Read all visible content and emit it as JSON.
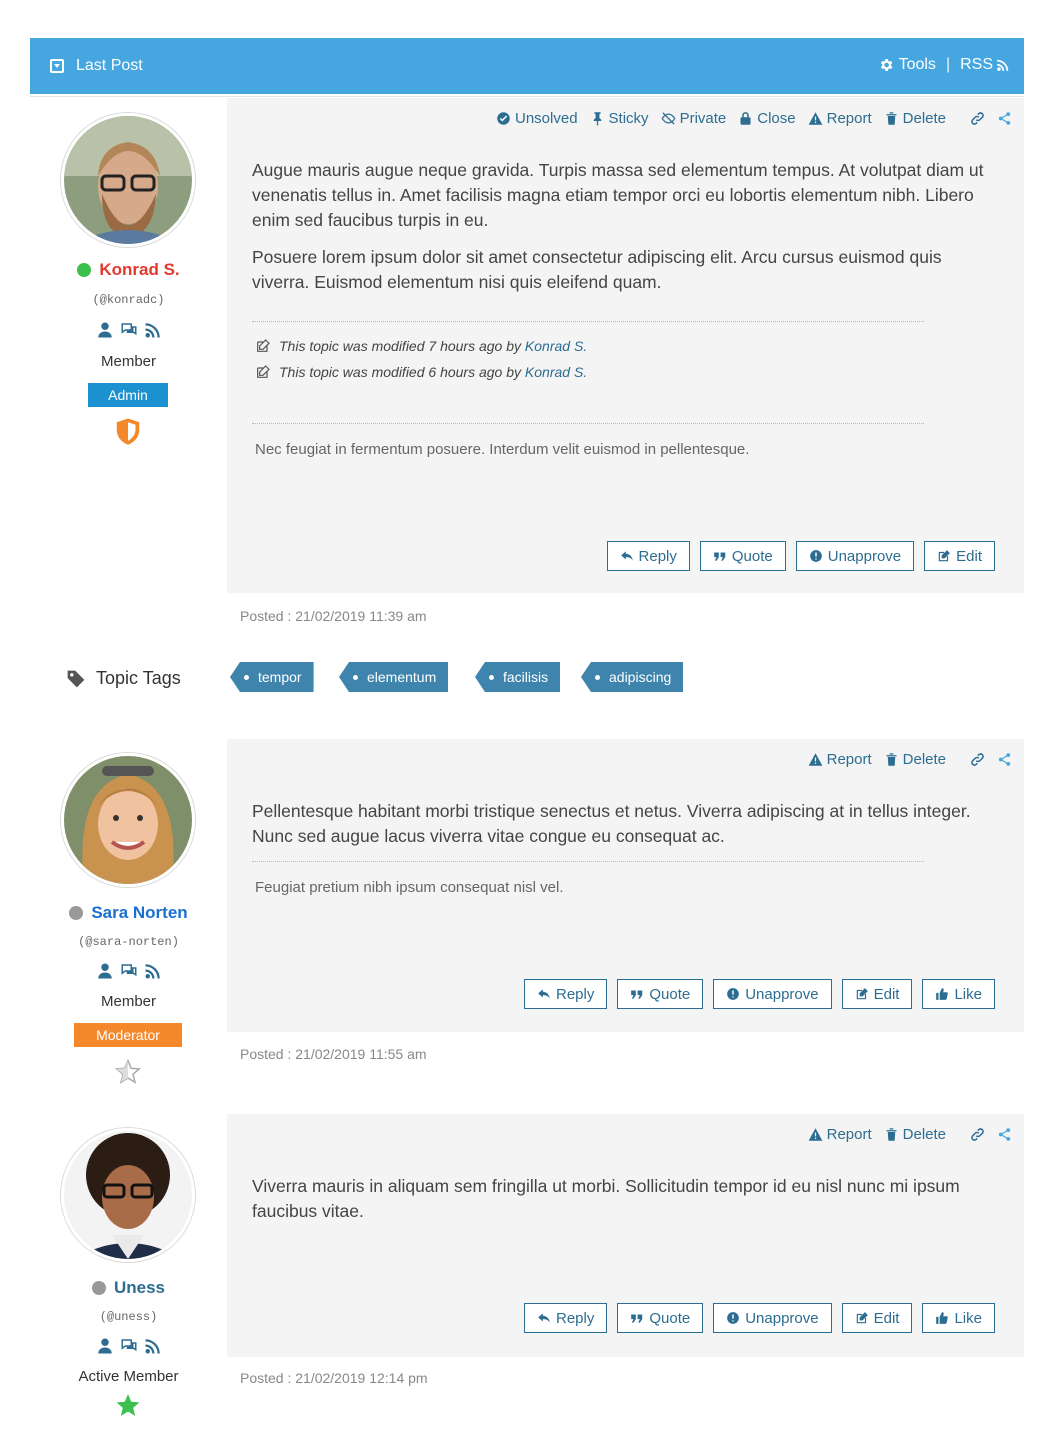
{
  "header": {
    "title": "Last Post",
    "tools": "Tools",
    "sep": "|",
    "rss": "RSS"
  },
  "posts": [
    {
      "author": {
        "name": "Konrad S.",
        "handle": "(@konradc)",
        "role": "Member",
        "badge": "Admin",
        "status_color": "#3cc04e",
        "name_color": "#e23a2b",
        "badge_color": "#1b91d0",
        "rank_icon": "shield-icon"
      },
      "actions": [
        "Unsolved",
        "Sticky",
        "Private",
        "Close",
        "Report",
        "Delete"
      ],
      "paragraphs": [
        "Augue mauris augue neque gravida. Turpis massa sed elementum tempus. At volutpat diam ut venenatis tellus in. Amet facilisis magna etiam tempor orci eu lobortis elementum nibh. Libero enim sed faucibus turpis in eu.",
        "Posuere lorem ipsum dolor sit amet consectetur adipiscing elit. Arcu cursus euismod quis viverra. Euismod elementum nisi quis eleifend quam."
      ],
      "modified": [
        {
          "text": "This topic was modified 7 hours ago by",
          "by": "Konrad S."
        },
        {
          "text": "This topic was modified 6 hours ago by",
          "by": "Konrad S."
        }
      ],
      "signature": "Nec feugiat in fermentum posuere. Interdum velit euismod in pellentesque.",
      "buttons": [
        "Reply",
        "Quote",
        "Unapprove",
        "Edit"
      ],
      "posted": "Posted : 21/02/2019 11:39 am"
    },
    {
      "author": {
        "name": "Sara Norten",
        "handle": "(@sara-norten)",
        "role": "Member",
        "badge": "Moderator",
        "status_color": "#999999",
        "name_color": "#1b6fd0",
        "badge_color": "#f5882a",
        "rank_icon": "half-star-icon"
      },
      "actions": [
        "Report",
        "Delete"
      ],
      "paragraphs": [
        "Pellentesque habitant morbi tristique senectus et netus. Viverra adipiscing at in tellus integer. Nunc sed augue lacus viverra vitae congue eu consequat ac."
      ],
      "signature": "Feugiat pretium nibh ipsum consequat nisl vel.",
      "buttons": [
        "Reply",
        "Quote",
        "Unapprove",
        "Edit",
        "Like"
      ],
      "posted": "Posted : 21/02/2019 11:55 am"
    },
    {
      "author": {
        "name": "Uness",
        "handle": "(@uness)",
        "role": "Active Member",
        "status_color": "#999999",
        "name_color": "#2d6d91",
        "rank_icon": "star-icon"
      },
      "actions": [
        "Report",
        "Delete"
      ],
      "paragraphs": [
        "Viverra mauris in aliquam sem fringilla ut morbi. Sollicitudin tempor id eu nisl nunc mi ipsum faucibus vitae."
      ],
      "buttons": [
        "Reply",
        "Quote",
        "Unapprove",
        "Edit",
        "Like"
      ],
      "posted": "Posted : 21/02/2019 12:14 pm"
    }
  ],
  "topic_tags": {
    "label": "Topic Tags",
    "tags": [
      "tempor",
      "elementum",
      "facilisis",
      "adipiscing"
    ]
  }
}
